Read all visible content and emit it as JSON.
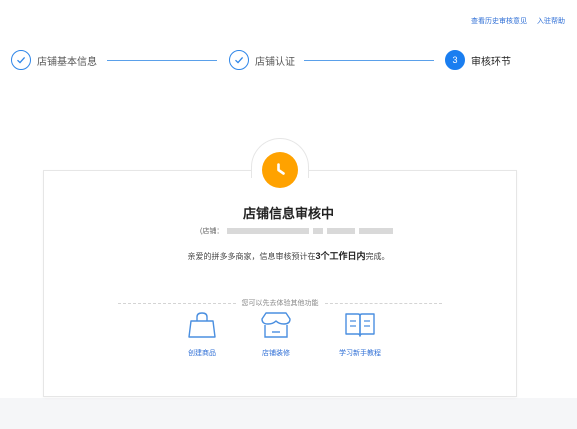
{
  "top_links": {
    "history": "查看历史审核意见",
    "help": "入驻帮助"
  },
  "steps": [
    {
      "label": "店铺基本信息",
      "state": "done"
    },
    {
      "label": "店铺认证",
      "state": "done"
    },
    {
      "label": "审核环节",
      "state": "active",
      "number": "3"
    }
  ],
  "status": {
    "title": "店铺信息审核中",
    "store_prefix": "(店铺：",
    "desc_before": "亲爱的拼多多商家，信息审核预计在",
    "desc_bold": "3个工作日内",
    "desc_after": "完成。",
    "clock_color": "#ffa200"
  },
  "features": {
    "hint": "您可以先去体验其他功能",
    "items": [
      {
        "label": "创建商品",
        "icon": "shopping-bag-icon"
      },
      {
        "label": "店铺装修",
        "icon": "storefront-icon"
      },
      {
        "label": "学习新手教程",
        "icon": "book-icon"
      }
    ]
  },
  "colors": {
    "accent": "#1a7ef0",
    "link": "#2f6fd6",
    "pending": "#ffa200"
  }
}
